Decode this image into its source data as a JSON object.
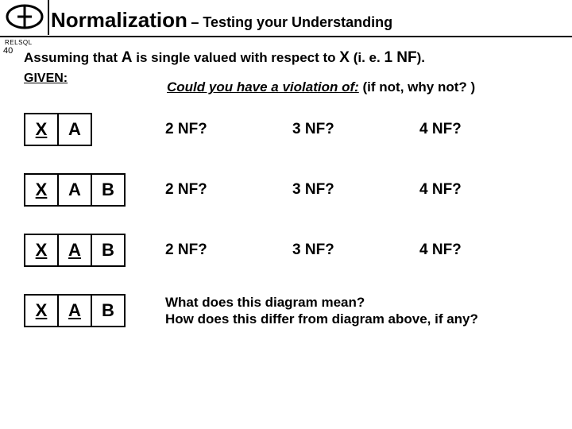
{
  "header": {
    "title_main": "Normalization",
    "title_sub": "– Testing your Understanding",
    "relsql": "RELSQL"
  },
  "page_number": "40",
  "intro": {
    "assuming_pre": "Assuming that ",
    "A": "A",
    "assuming_mid": " is single valued with respect to ",
    "X": "X",
    "assuming_post": " (i. e. ",
    "nf1": "1 NF",
    "assuming_close": ").",
    "given": "GIVEN:",
    "could_u": "Could you have a violation of:",
    "could_rest": "  (if not, why not? )"
  },
  "labels": {
    "X": "X",
    "A": "A",
    "B": "B",
    "nf2": "2 NF?",
    "nf3": "3 NF?",
    "nf4": "4 NF?"
  },
  "row4": {
    "line1": "What does this diagram mean?",
    "line2": "How does this differ from diagram above, if any?"
  }
}
